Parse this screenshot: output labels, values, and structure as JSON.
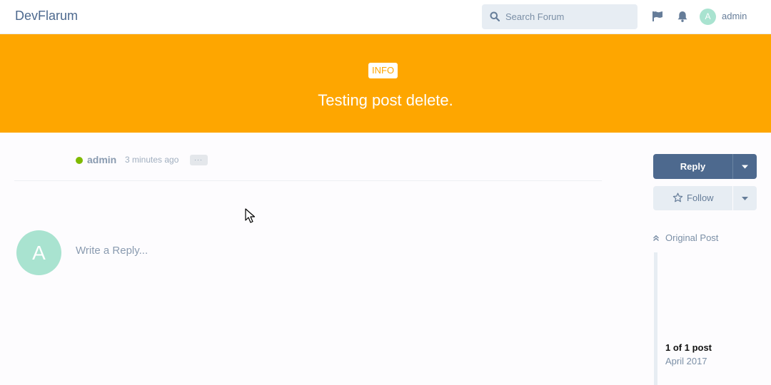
{
  "header": {
    "brand": "DevFlarum",
    "search_placeholder": "Search Forum",
    "icons": [
      "flag-icon",
      "bell-icon"
    ],
    "user": {
      "avatar_letter": "A",
      "name": "admin"
    }
  },
  "hero": {
    "tag": "INFO",
    "title": "Testing post delete.",
    "color": "#fea600"
  },
  "post": {
    "author": "admin",
    "time": "3 minutes ago",
    "menu": "···",
    "online_color": "#7fba00"
  },
  "composer": {
    "avatar_letter": "A",
    "placeholder": "Write a Reply..."
  },
  "sidebar": {
    "reply_label": "Reply",
    "follow_label": "Follow",
    "original_post": "Original Post",
    "scrubber": {
      "count": "1 of 1 post",
      "date": "April 2017"
    }
  },
  "colors": {
    "primary": "#4d698e",
    "control_bg": "#e7edf3",
    "avatar": "#a9e3d0"
  }
}
